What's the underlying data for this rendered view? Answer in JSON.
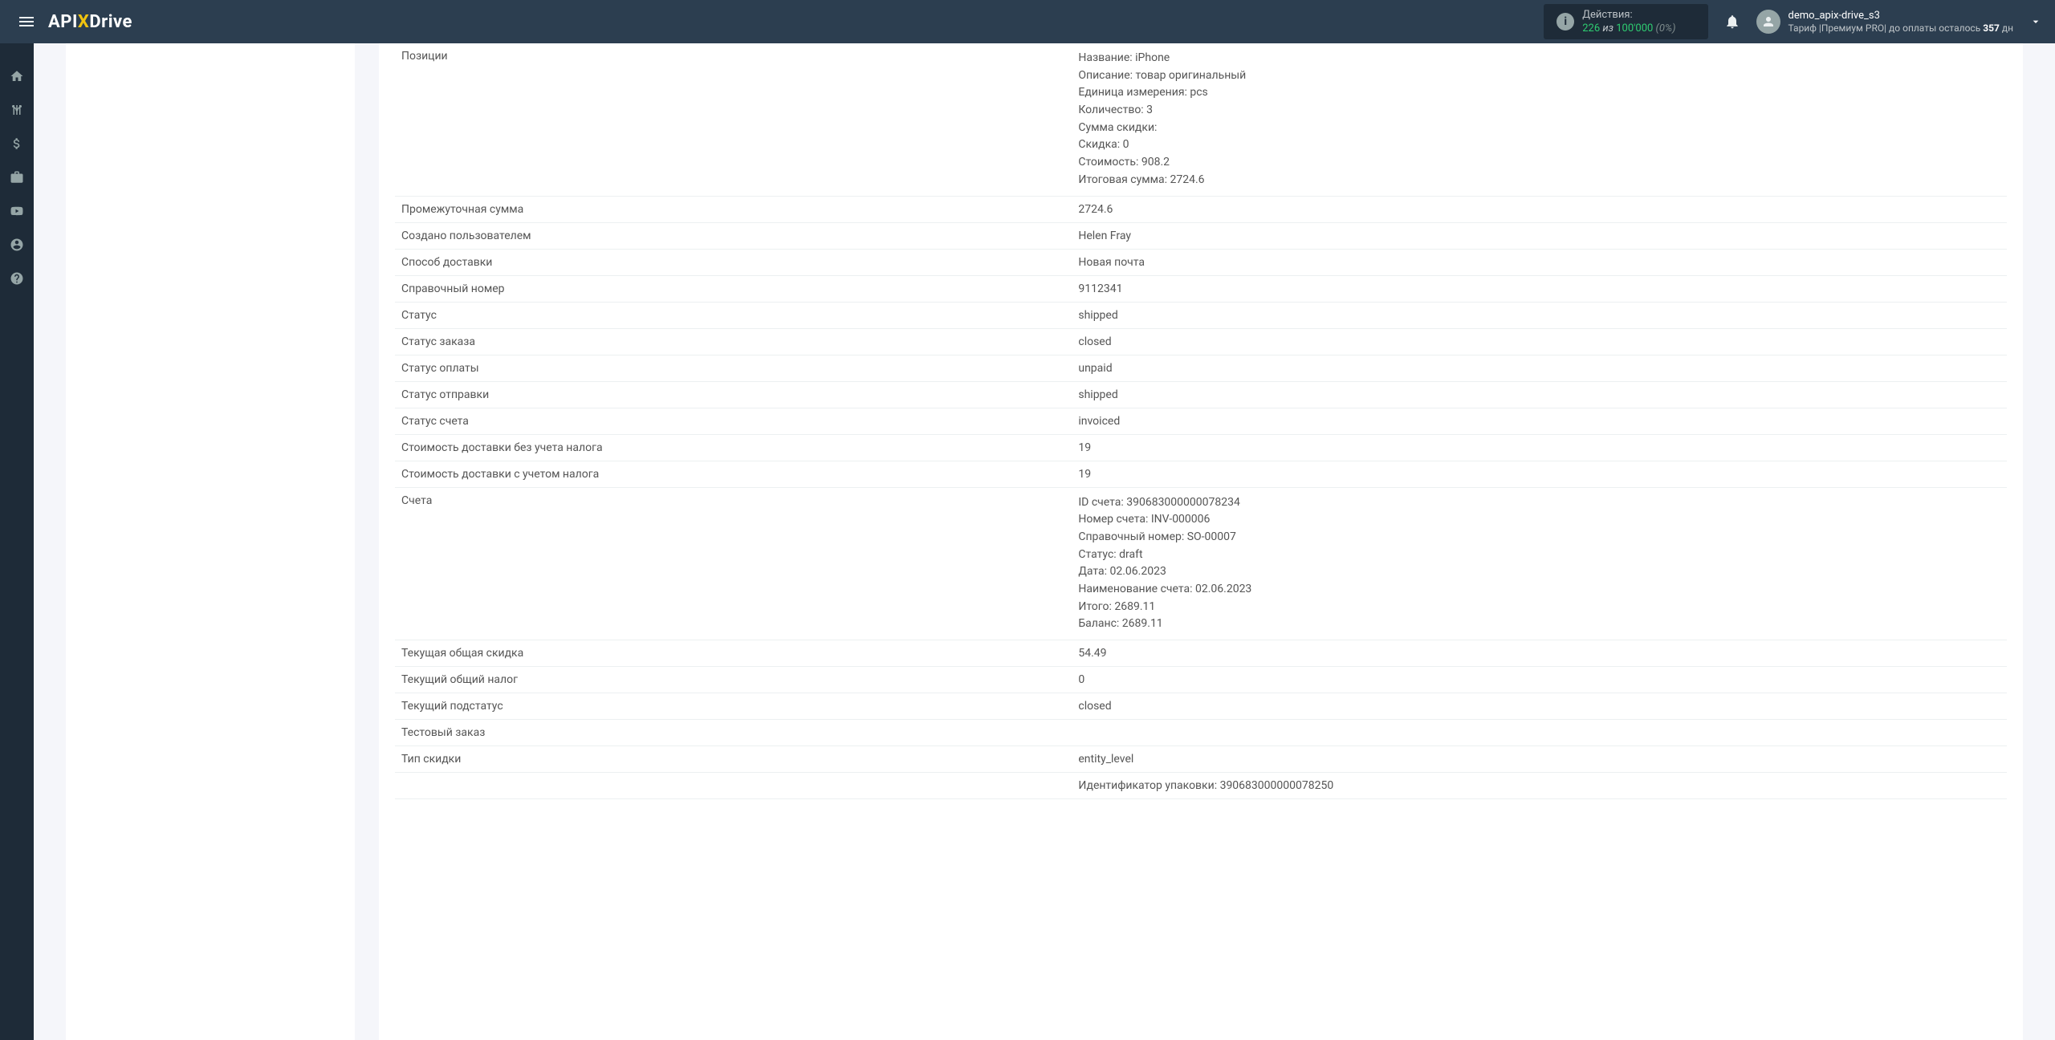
{
  "header": {
    "actions_label": "Действия:",
    "actions_count": "226",
    "actions_of": " из ",
    "actions_max": "100'000",
    "actions_pct": " (0%)",
    "username": "demo_apix-drive_s3",
    "tariff_prefix": "Тариф |",
    "tariff_name": "Премиум PRO",
    "tariff_sep": "|",
    "days_prefix": " до оплаты осталось ",
    "days_count": "357",
    "days_suffix": " дн"
  },
  "logo": {
    "api": "API",
    "x": "X",
    "drive": "Drive"
  },
  "rows": [
    {
      "label": "Позиции",
      "multiline": true,
      "lines": [
        "Название: iPhone",
        "Описание: товар оригинальный",
        "Единица измерения: pcs",
        "Количество: 3",
        "Сумма скидки:",
        "Скидка: 0",
        "Стоимость: 908.2",
        "Итоговая сумма: 2724.6"
      ]
    },
    {
      "label": "Промежуточная сумма",
      "value": "2724.6"
    },
    {
      "label": "Создано пользователем",
      "value": "Helen Fray"
    },
    {
      "label": "Способ доставки",
      "value": "Новая почта"
    },
    {
      "label": "Справочный номер",
      "value": "9112341"
    },
    {
      "label": "Статус",
      "value": "shipped"
    },
    {
      "label": "Статус заказа",
      "value": "closed"
    },
    {
      "label": "Статус оплаты",
      "value": "unpaid"
    },
    {
      "label": "Статус отправки",
      "value": "shipped"
    },
    {
      "label": "Статус счета",
      "value": "invoiced"
    },
    {
      "label": "Стоимость доставки без учета налога",
      "value": "19"
    },
    {
      "label": "Стоимость доставки с учетом налога",
      "value": "19"
    },
    {
      "label": "Счета",
      "multiline": true,
      "lines": [
        "ID счета: 390683000000078234",
        "Номер счета: INV-000006",
        "Справочный номер: SO-00007",
        "Статус: draft",
        "Дата: 02.06.2023",
        "Наименование счета: 02.06.2023",
        "Итого: 2689.11",
        "Баланс: 2689.11"
      ]
    },
    {
      "label": "Текущая общая скидка",
      "value": "54.49"
    },
    {
      "label": "Текущий общий налог",
      "value": "0"
    },
    {
      "label": "Текущий подстатус",
      "value": "closed"
    },
    {
      "label": "Тестовый заказ",
      "value": ""
    },
    {
      "label": "Тип скидки",
      "value": "entity_level"
    },
    {
      "label": "",
      "value": "Идентификатор упаковки: 390683000000078250"
    }
  ]
}
